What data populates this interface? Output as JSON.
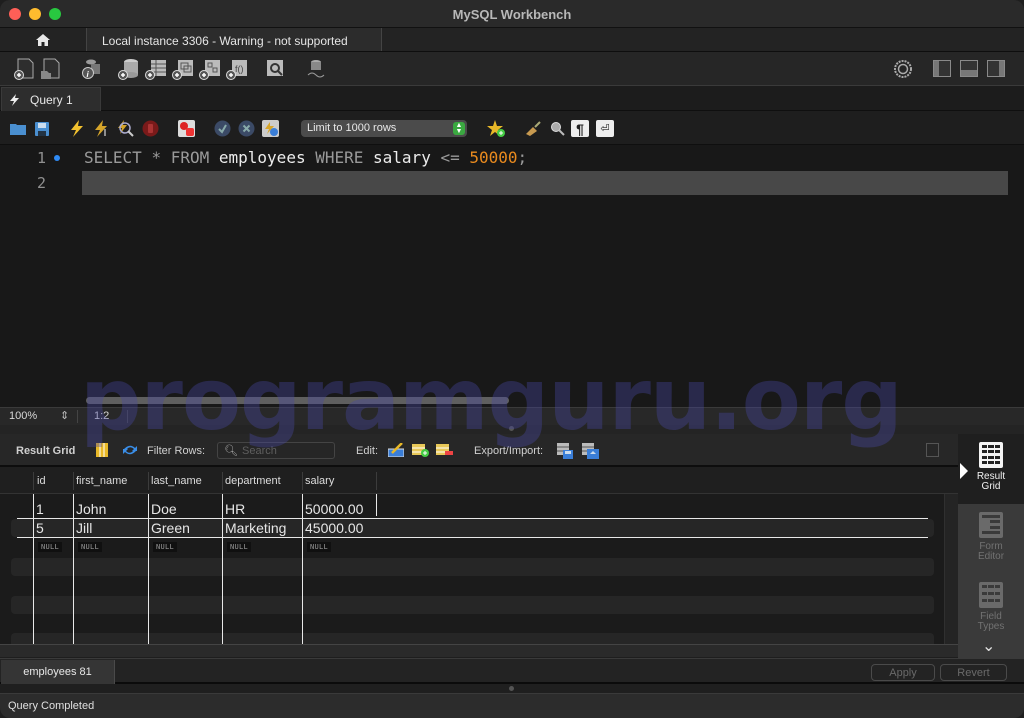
{
  "window": {
    "title": "MySQL Workbench"
  },
  "connection_tabs": {
    "home_icon": "home-icon",
    "active_tab": "Local instance 3306 - Warning - not supported"
  },
  "main_toolbar": {
    "icons": [
      "new-sql-tab-icon",
      "open-sql-script-icon",
      "schema-inspector-icon",
      "create-schema-icon",
      "create-table-icon",
      "create-view-icon",
      "create-procedure-icon",
      "create-function-icon",
      "search-table-data-icon",
      "reconnect-icon"
    ],
    "right_icons": [
      "settings-icon",
      "toggle-sidebar-icon",
      "toggle-output-icon",
      "toggle-secondary-sidebar-icon"
    ]
  },
  "query_tabs": [
    {
      "label": "Query 1",
      "icon": "lightning-icon",
      "active": true
    }
  ],
  "query_toolbar": {
    "icons": [
      "open-file-icon",
      "save-icon",
      "execute-icon",
      "execute-current-icon",
      "explain-icon",
      "stop-icon",
      "toggle-error-continue-icon",
      "commit-icon",
      "rollback-icon",
      "autocommit-icon"
    ],
    "limit_select": "Limit to 1000 rows",
    "right_icons": [
      "add-snippet-icon",
      "beautify-icon",
      "find-icon",
      "invisible-chars-icon",
      "word-wrap-icon"
    ]
  },
  "editor": {
    "lines": [
      {
        "number": "1",
        "tokens": [
          {
            "t": "SELECT",
            "c": "kw"
          },
          {
            "t": " ",
            "c": "ident"
          },
          {
            "t": "*",
            "c": "kw"
          },
          {
            "t": " ",
            "c": "ident"
          },
          {
            "t": "FROM",
            "c": "kw"
          },
          {
            "t": " employees ",
            "c": "ident"
          },
          {
            "t": "WHERE",
            "c": "kw"
          },
          {
            "t": " salary ",
            "c": "ident"
          },
          {
            "t": "<=",
            "c": "kw"
          },
          {
            "t": " ",
            "c": "ident"
          },
          {
            "t": "50000",
            "c": "num"
          },
          {
            "t": ";",
            "c": "kw"
          }
        ]
      },
      {
        "number": "2",
        "tokens": []
      }
    ],
    "zoom": "100%",
    "cursor_position": "1:2"
  },
  "result_toolbar": {
    "result_grid_label": "Result Grid",
    "filter_label": "Filter Rows:",
    "search_placeholder": "Search",
    "edit_label": "Edit:",
    "export_label": "Export/Import:"
  },
  "grid": {
    "columns": [
      "id",
      "first_name",
      "last_name",
      "department",
      "salary"
    ],
    "rows": [
      [
        "1",
        "John",
        "Doe",
        "HR",
        "50000.00"
      ],
      [
        "5",
        "Jill",
        "Green",
        "Marketing",
        "45000.00"
      ]
    ],
    "null_row": [
      "NULL",
      "NULL",
      "NULL",
      "NULL",
      "NULL"
    ]
  },
  "side_panel": {
    "items": [
      {
        "label_1": "Result",
        "label_2": "Grid",
        "active": true
      },
      {
        "label_1": "Form",
        "label_2": "Editor",
        "active": false
      },
      {
        "label_1": "Field",
        "label_2": "Types",
        "active": false
      }
    ]
  },
  "bottom": {
    "result_tab": "employees 81",
    "apply": "Apply",
    "revert": "Revert"
  },
  "status": {
    "text": "Query Completed"
  },
  "watermark": "programguru.org"
}
